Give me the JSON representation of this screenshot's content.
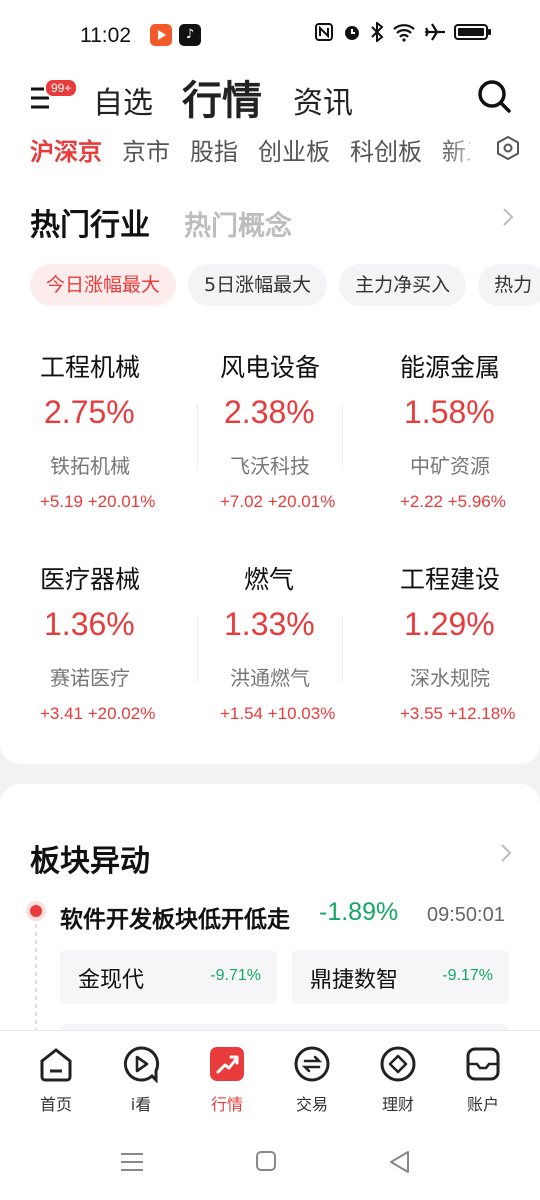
{
  "status_bar": {
    "time": "11:02",
    "tiktok_glyph": "♪",
    "icons": [
      "nfc-icon",
      "alarm-icon",
      "bluetooth-icon",
      "wifi-icon",
      "airplane-icon",
      "battery-icon"
    ]
  },
  "header": {
    "badge": "99+",
    "tabs": {
      "watchlist": "自选",
      "market": "行情",
      "news": "资讯"
    },
    "sub_tabs": [
      "沪深京",
      "京市",
      "股指",
      "创业板",
      "科创板",
      "新三"
    ]
  },
  "hot_section": {
    "tab_industry": "热门行业",
    "tab_concept": "热门概念",
    "chips": [
      "今日涨幅最大",
      "5日涨幅最大",
      "主力净买入",
      "热力"
    ],
    "items": [
      {
        "name": "工程机械",
        "pct": "2.75%",
        "leader": "铁拓机械",
        "change": "+5.19 +20.01%"
      },
      {
        "name": "风电设备",
        "pct": "2.38%",
        "leader": "飞沃科技",
        "change": "+7.02 +20.01%"
      },
      {
        "name": "能源金属",
        "pct": "1.58%",
        "leader": "中矿资源",
        "change": "+2.22 +5.96%"
      },
      {
        "name": "医疗器械",
        "pct": "1.36%",
        "leader": "赛诺医疗",
        "change": "+3.41 +20.02%"
      },
      {
        "name": "燃气",
        "pct": "1.33%",
        "leader": "洪通燃气",
        "change": "+1.54 +10.03%"
      },
      {
        "name": "工程建设",
        "pct": "1.29%",
        "leader": "深水规院",
        "change": "+3.55 +12.18%"
      }
    ]
  },
  "moves_section": {
    "title": "板块异动",
    "event": {
      "text": "软件开发板块低开低走",
      "pct": "-1.89%",
      "time": "09:50:01",
      "stocks": [
        {
          "name": "金现代",
          "change": "-9.71%"
        },
        {
          "name": "鼎捷数智",
          "change": "-9.17%"
        }
      ]
    }
  },
  "bottom_nav": [
    "首页",
    "i看",
    "行情",
    "交易",
    "理财",
    "账户"
  ],
  "colors": {
    "up": "#e93b3b",
    "down": "#14a765",
    "accent": "#e93b3b"
  }
}
